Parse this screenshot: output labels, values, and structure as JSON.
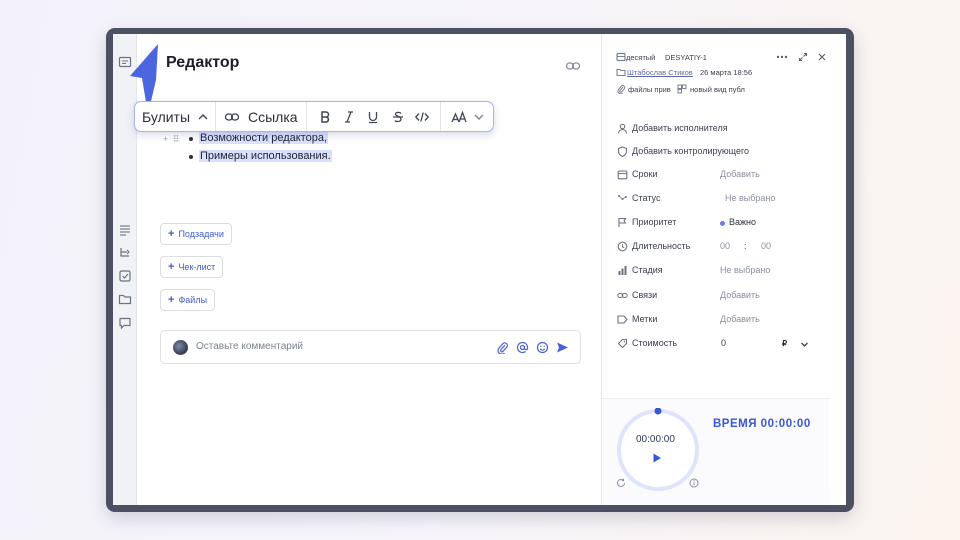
{
  "editor": {
    "title": "Редактор",
    "toolbar": {
      "list_type": "Булиты",
      "link_label": "Ссылка"
    },
    "bullets": [
      "Возможности редактора,",
      "Примеры использования."
    ],
    "subtasks_label": "Подзадачи",
    "checklist_label": "Чек-лист",
    "files_label": "Файлы",
    "comment_placeholder": "Оставьте комментарий"
  },
  "task": {
    "project": "десятый",
    "task_id": "DESYATIY-1",
    "author": "Штабослав Стиков",
    "date": "26 марта 18:56",
    "tag_files": "файлы прив",
    "tag_view": "новый вид публ",
    "add_assignee": "Добавить исполнителя",
    "add_controller": "Добавить контролирующего",
    "props": [
      {
        "label": "Сроки",
        "value": "Добавить",
        "icon": "calendar-icon"
      },
      {
        "label": "Статус",
        "value": "Не выбрано",
        "icon": "status-icon"
      },
      {
        "label": "Приоритет",
        "value": "Важно",
        "icon": "priority-icon"
      },
      {
        "label": "Длительность",
        "hours": "00",
        "sep": ":",
        "minutes": "00",
        "icon": "clock-icon"
      },
      {
        "label": "Стадия",
        "value": "Не выбрано",
        "icon": "stage-icon"
      },
      {
        "label": "Связи",
        "value": "Добавить",
        "icon": "link-icon"
      },
      {
        "label": "Метки",
        "value": "Добавить",
        "icon": "tag-icon"
      },
      {
        "label": "Стоимость",
        "value": "0",
        "currency": "₽",
        "icon": "cost-icon"
      }
    ],
    "priority_color": "#6b7bdc"
  },
  "timer": {
    "time": "00:00:00",
    "total_label": "ВРЕМЯ 00:00:00"
  },
  "colors": {
    "accent": "#3a55d4",
    "selection": "#d8e0fb",
    "frame": "#4b5163"
  }
}
